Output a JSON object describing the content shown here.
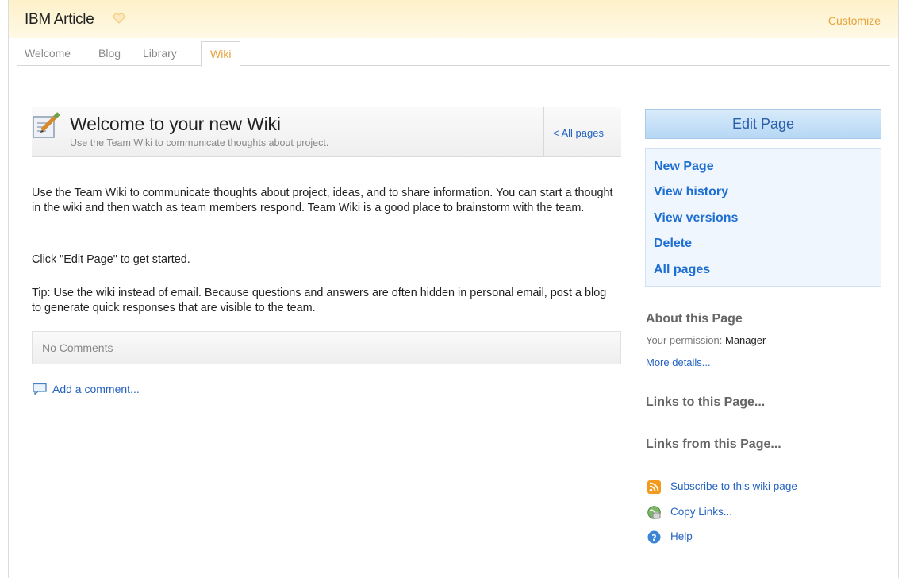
{
  "app": {
    "title": "IBM Article",
    "customize_label": "Customize"
  },
  "tabs": [
    {
      "label": "Welcome",
      "active": false
    },
    {
      "label": "Blog",
      "active": false
    },
    {
      "label": "Library",
      "active": false
    },
    {
      "label": "Wiki",
      "active": true
    }
  ],
  "wiki": {
    "title": "Welcome to your new Wiki",
    "subtitle": "Use the Team Wiki to communicate thoughts about project.",
    "all_pages_link": "< All pages",
    "paragraphs": [
      "Use the Team Wiki to communicate thoughts about project, ideas, and to share information. You can start a thought in the wiki and then watch as team members respond. Team Wiki is a good place to brainstorm with the team.",
      "Click \"Edit Page\" to get started.",
      "Tip: Use the wiki instead of email. Because questions and answers are often hidden in personal email, post a blog to generate quick responses that are visible to the team."
    ],
    "comments_label": "No Comments",
    "add_comment_label": "Add a comment..."
  },
  "sidebar": {
    "edit_button": "Edit Page",
    "actions": [
      "New Page",
      "View history",
      "View versions",
      "Delete",
      "All pages"
    ],
    "about_title": "About this Page",
    "permission_label": "Your permission:",
    "permission_value": "Manager",
    "more_details": "More details...",
    "links_to": "Links to this Page...",
    "links_from": "Links from this Page...",
    "utilities": [
      {
        "icon": "rss-feed-icon",
        "label": "Subscribe to this wiki page"
      },
      {
        "icon": "copy-links-icon",
        "label": "Copy Links..."
      },
      {
        "icon": "help-icon",
        "label": "Help"
      }
    ]
  },
  "colors": {
    "accent_orange": "#e8a23b",
    "link_blue": "#2563c0",
    "action_blue": "#1f6fd1",
    "header_yellow": "#fdf1c9"
  }
}
